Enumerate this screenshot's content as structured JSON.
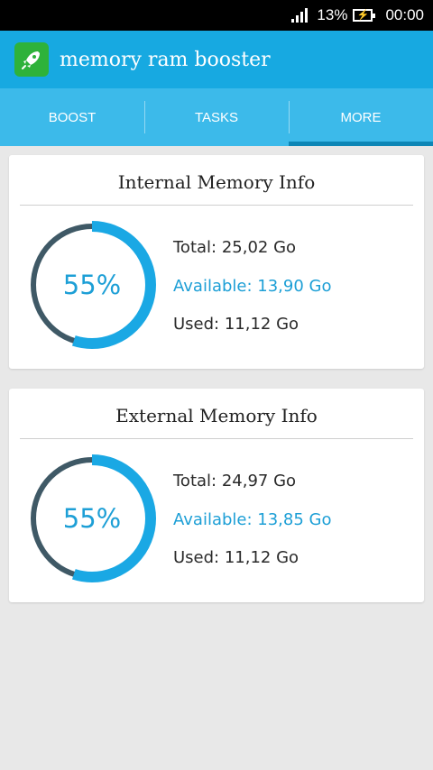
{
  "status_bar": {
    "battery_pct": "13%",
    "time": "00:00"
  },
  "app": {
    "title": "memory ram booster",
    "icon": "rocket-icon"
  },
  "tabs": [
    {
      "label": "BOOST",
      "active": false
    },
    {
      "label": "TASKS",
      "active": false
    },
    {
      "label": "MORE",
      "active": true
    }
  ],
  "colors": {
    "accent": "#17a9e1",
    "tab_bg": "#3cbaea",
    "gauge_used": "#1aa8e4",
    "gauge_free": "#3f5966",
    "available_text": "#1d9fd6"
  },
  "internal": {
    "title": "Internal Memory Info",
    "percent_label": "55%",
    "used_fraction": 0.55,
    "total": "Total: 25,02 Go",
    "available": "Available: 13,90 Go",
    "used": "Used: 11,12 Go"
  },
  "external": {
    "title": "External Memory Info",
    "percent_label": "55%",
    "used_fraction": 0.55,
    "total": "Total: 24,97 Go",
    "available": "Available: 13,85 Go",
    "used": "Used: 11,12 Go"
  }
}
